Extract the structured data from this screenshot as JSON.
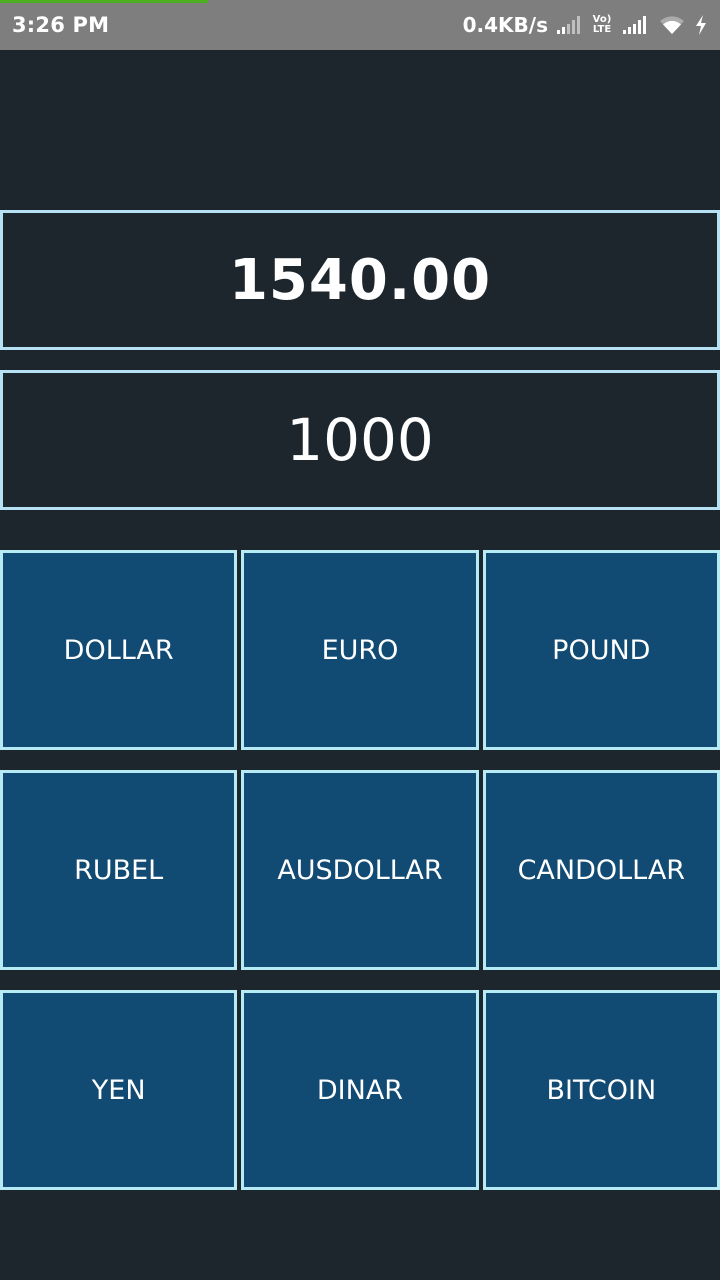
{
  "status_bar": {
    "time": "3:26 PM",
    "network_speed": "0.4KB/s",
    "volte_top": "Vo)",
    "volte_bottom": "LTE"
  },
  "result_display": {
    "value": "1540.00"
  },
  "amount_input": {
    "value": "1000"
  },
  "currency_buttons": [
    [
      "DOLLAR",
      "EURO",
      "POUND"
    ],
    [
      "RUBEL",
      "AUSDOLLAR",
      "CANDOLLAR"
    ],
    [
      "YEN",
      "DINAR",
      "BITCOIN"
    ]
  ],
  "colors": {
    "background": "#1c262c",
    "status_bar": "#7e7e7e",
    "button_fill": "#114a73",
    "border": "#b6e0f4",
    "progress": "#4caf1f"
  },
  "icons": [
    "signal-weak-icon",
    "volte-icon",
    "signal-strong-icon",
    "wifi-icon",
    "charging-icon"
  ]
}
